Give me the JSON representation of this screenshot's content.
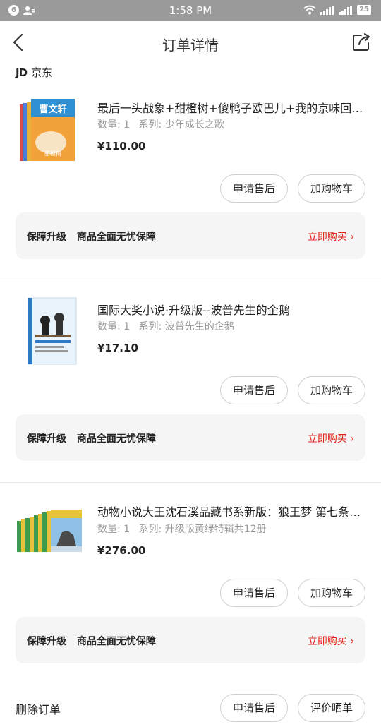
{
  "status_bar": {
    "badge_num": "6",
    "time": "1:58 PM",
    "battery": "25"
  },
  "nav": {
    "title": "订单详情"
  },
  "shop": {
    "logo_text": "JD",
    "name": "京东"
  },
  "products": [
    {
      "title": "最后一头战象+甜橙树+傻鸭子欧巴儿+我的京味回忆录",
      "qty": "数量: 1",
      "series": "系列: 少年成长之歌",
      "price": "¥110.00",
      "thumb_text": "曹文轩",
      "thumb_sub": "甜橙树",
      "after_sale": "申请售后",
      "add_cart": "加购物车",
      "guarantee_a": "保障升级",
      "guarantee_b": "商品全面无忧保障",
      "buy_now": "立即购买 ›"
    },
    {
      "title": "国际大奖小说·升级版--波普先生的企鹅",
      "qty": "数量: 1",
      "series": "系列: 波普先生的企鹅",
      "price": "¥17.10",
      "after_sale": "申请售后",
      "add_cart": "加购物车",
      "guarantee_a": "保障升级",
      "guarantee_b": "商品全面无忧保障",
      "buy_now": "立即购买 ›"
    },
    {
      "title": "动物小说大王沈石溪品藏书系新版：狼王梦 第七条猎狗",
      "qty": "数量: 1",
      "series": "系列: 升级版黄绿特辑共12册",
      "price": "¥276.00",
      "after_sale": "申请售后",
      "add_cart": "加购物车",
      "guarantee_a": "保障升级",
      "guarantee_b": "商品全面无忧保障",
      "buy_now": "立即购买 ›"
    }
  ],
  "bottom_bar": {
    "delete_order": "删除订单",
    "after_sale": "申请售后",
    "review": "评价晒单"
  },
  "colors": {
    "accent_red": "#e2231a",
    "status_bar": "#9a9a9a",
    "card_bg": "#f5f5f5"
  }
}
